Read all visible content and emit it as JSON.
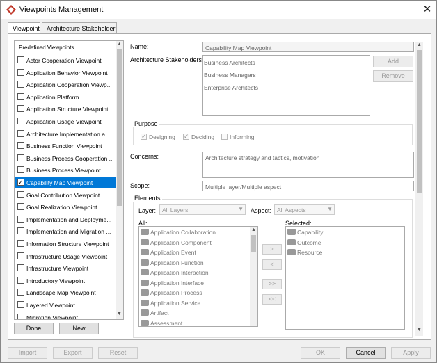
{
  "window": {
    "title": "Viewpoints Management"
  },
  "tabs": [
    {
      "label": "Viewpoint"
    },
    {
      "label": "Architecture Stakeholder"
    }
  ],
  "viewpoints": {
    "group_label": "Predefined Viewpoints",
    "items": [
      "Actor Cooperation Viewpoint",
      "Application Behavior Viewpoint",
      "Application Cooperation Viewp...",
      "Application Platform",
      "Application Structure Viewpoint",
      "Application Usage Viewpoint",
      "Architecture Implementation a...",
      "Business Function Viewpoint",
      "Business Process Cooperation ...",
      "Business Process Viewpoint",
      "Capability Map Viewpoint",
      "Goal Contribution Viewpoint",
      "Goal Realization Viewpoint",
      "Implementation and Deployme...",
      "Implementation and Migration ...",
      "Information Structure Viewpoint",
      "Infrastructure Usage Viewpoint",
      "Infrastructure Viewpoint",
      "Introductory Viewpoint",
      "Landscape Map Viewpoint",
      "Layered Viewpoint",
      "Migration Viewpoint"
    ],
    "selected_index": 10,
    "done_label": "Done",
    "new_label": "New"
  },
  "details": {
    "name_label": "Name:",
    "name_value": "Capability Map Viewpoint",
    "stakeholders_label": "Architecture Stakeholders:",
    "stakeholders": [
      "Business Architects",
      "Business Managers",
      "Enterprise Architects"
    ],
    "add_label": "Add",
    "remove_label": "Remove",
    "purpose_label": "Purpose",
    "purpose_options": [
      {
        "label": "Designing",
        "checked": true
      },
      {
        "label": "Deciding",
        "checked": true
      },
      {
        "label": "Informing",
        "checked": false
      }
    ],
    "concerns_label": "Concerns:",
    "concerns_value": "Architecture strategy and tactics, motivation",
    "scope_label": "Scope:",
    "scope_value": "Multiple layer/Multiple aspect",
    "elements_label": "Elements",
    "layer_label": "Layer:",
    "layer_value": "All Layers",
    "aspect_label": "Aspect:",
    "aspect_value": "All Aspects",
    "all_label": "All:",
    "all_items": [
      "Application Collaboration",
      "Application Component",
      "Application Event",
      "Application Function",
      "Application Interaction",
      "Application Interface",
      "Application Process",
      "Application Service",
      "Artifact",
      "Assessment"
    ],
    "selected_label": "Selected:",
    "selected_items": [
      "Capability",
      "Outcome",
      "Resource"
    ],
    "move_buttons": [
      ">",
      "<",
      ">>",
      "<<"
    ]
  },
  "footer": {
    "import_label": "Import",
    "export_label": "Export",
    "reset_label": "Reset",
    "ok_label": "OK",
    "cancel_label": "Cancel",
    "apply_label": "Apply"
  },
  "colors": {
    "selection": "#0078d7",
    "app_icon": "#c0392b"
  }
}
